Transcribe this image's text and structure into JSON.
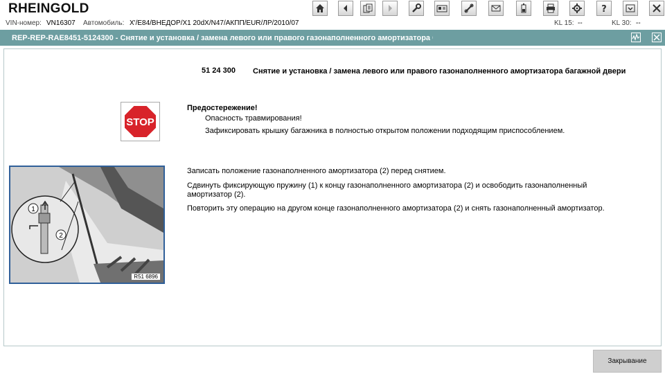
{
  "app": {
    "title": "RHEINGOLD"
  },
  "toolbar": {
    "buttons": [
      {
        "name": "home-button",
        "icon": "home-icon"
      },
      {
        "name": "back-button",
        "icon": "arrow-left-icon"
      },
      {
        "name": "documents-button",
        "icon": "documents-icon"
      },
      {
        "name": "forward-button",
        "icon": "arrow-right-icon"
      },
      {
        "name": "service-functions-button",
        "icon": "wrench-icon"
      },
      {
        "name": "vehicle-info-button",
        "icon": "card-icon"
      },
      {
        "name": "measuring-button",
        "icon": "probe-icon"
      },
      {
        "name": "messages-button",
        "icon": "envelope-icon"
      },
      {
        "name": "battery-button",
        "icon": "battery-icon"
      },
      {
        "name": "print-button",
        "icon": "printer-icon"
      },
      {
        "name": "settings-button",
        "icon": "gear-icon"
      },
      {
        "name": "help-button",
        "icon": "question-icon"
      },
      {
        "name": "minimize-button",
        "icon": "minimize-icon"
      },
      {
        "name": "exit-button",
        "icon": "close-icon"
      }
    ]
  },
  "vehicle": {
    "vin_label": "VIN-номер:",
    "vin_value": "VN16307",
    "car_label": "Автомобиль:",
    "car_value": "X'/E84/ВНЕДОР/X1 20dX/N47/АКПП/EUR/ЛР/2010/07",
    "kl15_label": "KL 15:",
    "kl15_value": "--",
    "kl30_label": "KL 30:",
    "kl30_value": "--"
  },
  "document": {
    "window_title": "REP-REP-RAE8451-5124300  -  Снятие и установка / замена левого или правого газонаполненного амортизатора багажной двер",
    "number": "51 24 300",
    "title": "Снятие и установка / замена левого или правого газонаполненного амортизатора багажной двери",
    "warning_heading": "Предостережение!",
    "warning_line1": "Опасность травмирования!",
    "warning_line2": "Зафиксировать крышку багажника в полностью открытом положении подходящим приспособлением.",
    "stop_sign_text": "STOP",
    "steps": [
      "Записать положение газонаполненного амортизатора (2) перед снятием.",
      "Сдвинуть фиксирующую пружину (1) к концу газонаполненного амортизатора (2) и освободить газонаполненный амортизатор (2).",
      "Повторить эту операцию на другом конце газонаполненного амортизатора (2) и снять газонаполненный амортизатор."
    ],
    "illustration_callouts": [
      "1",
      "2"
    ],
    "illustration_label": "R51 6896"
  },
  "footer": {
    "close_label": "Закрывание"
  },
  "colors": {
    "titlebar": "#6d9ea1",
    "illustration_border": "#2f5f99",
    "stop_red": "#d8232a"
  }
}
